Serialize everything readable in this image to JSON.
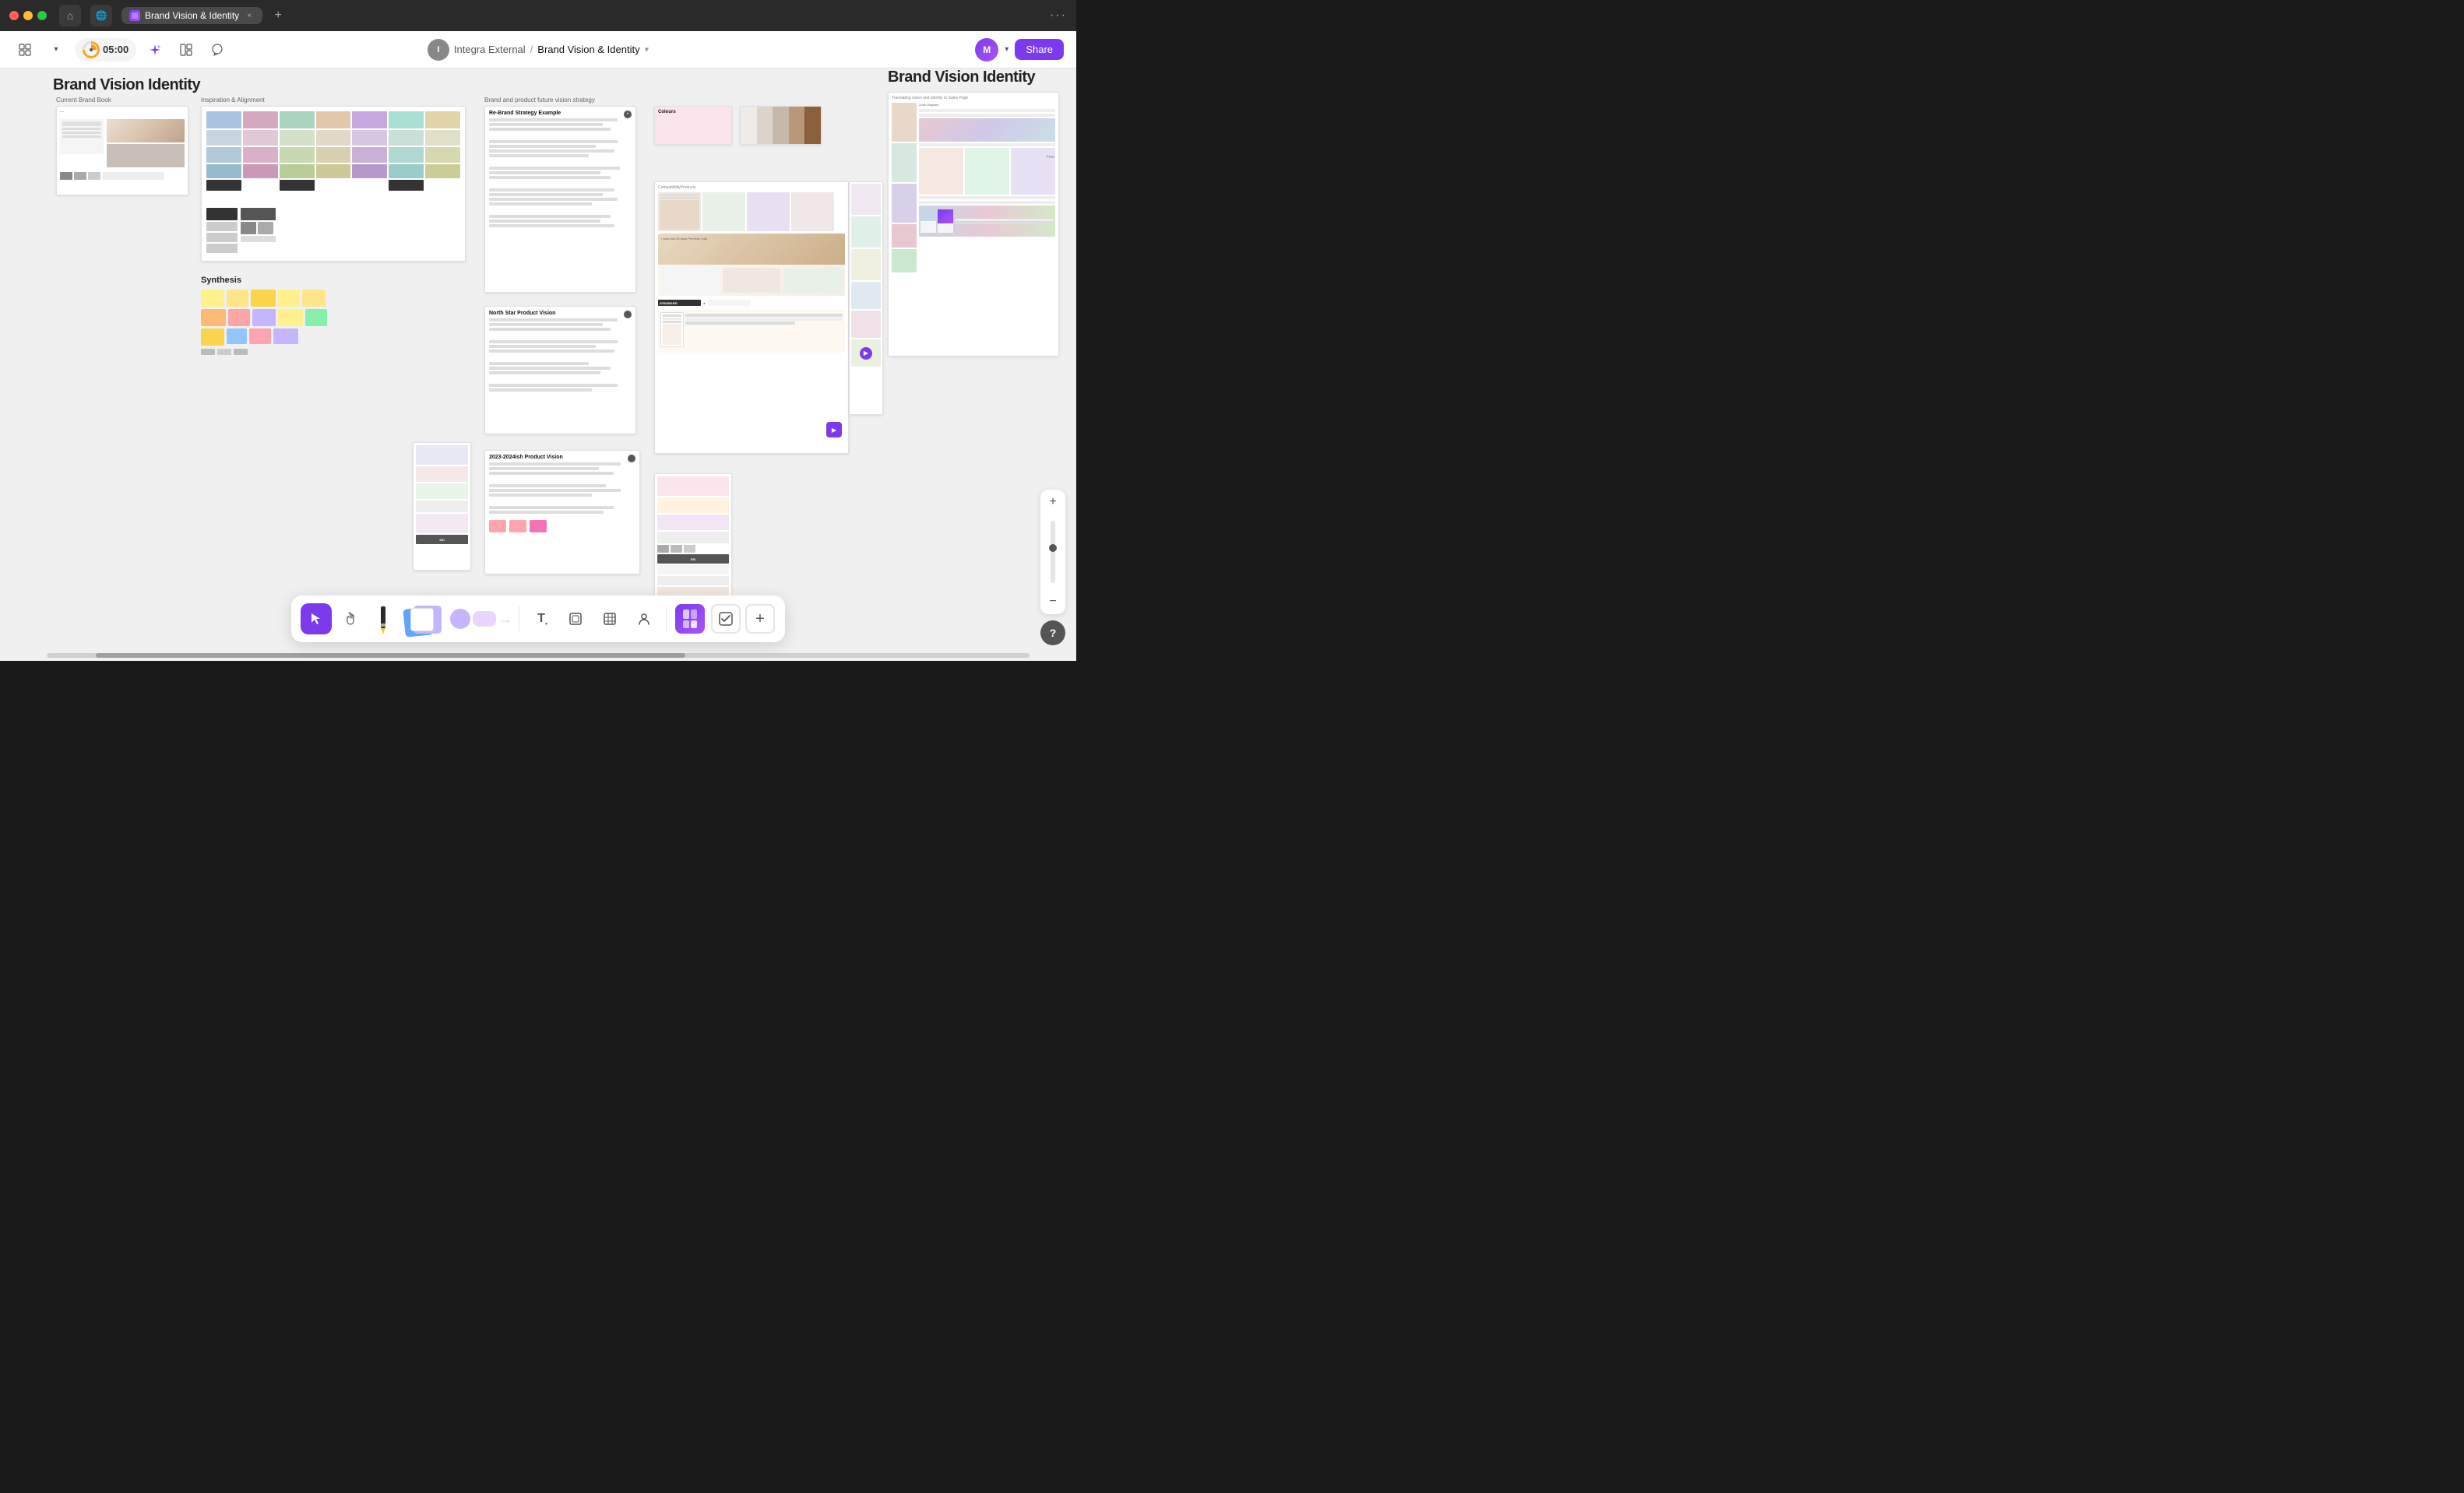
{
  "titlebar": {
    "tab_label": "Brand Vision & Identity",
    "new_tab_label": "+",
    "menu_dots": "···"
  },
  "toolbar": {
    "timer": "05:00",
    "breadcrumb_workspace": "Integra External",
    "breadcrumb_separator": "/",
    "breadcrumb_page": "Brand Vision & Identity",
    "share_label": "Share",
    "avatar_initials": "M",
    "integra_initials": "I",
    "dropdown_arrow": "▾"
  },
  "canvas": {
    "big_label_1": "Brand Vision Identity",
    "big_label_2": "Brand Vision Identity",
    "synthesis_label": "Synthesis",
    "frame_labels": [
      "Current Brand Book",
      "Inspiration & Alignment",
      "Brand and product future vision strategy"
    ],
    "cards": [
      {
        "id": "rebrand-strategy",
        "title": "Re-Brand Strategy Example"
      },
      {
        "id": "north-star",
        "title": "North Star Product Vision"
      },
      {
        "id": "product-vision-2024",
        "title": "2023-2024ish  Product Vision"
      },
      {
        "id": "colours",
        "title": "Colours"
      }
    ]
  },
  "bottom_toolbar": {
    "select_label": "Select",
    "hand_label": "Hand",
    "pencil_label": "Pencil",
    "notes_label": "Sticky Notes",
    "shapes_label": "Shapes",
    "text_label": "T",
    "frame_label": "Frame",
    "table_label": "Table",
    "connect_label": "Connect",
    "templates_label": "Templates",
    "tasks_label": "Tasks",
    "more_label": "+"
  },
  "zoom": {
    "plus_label": "+",
    "minus_label": "−"
  },
  "help": {
    "label": "?"
  }
}
